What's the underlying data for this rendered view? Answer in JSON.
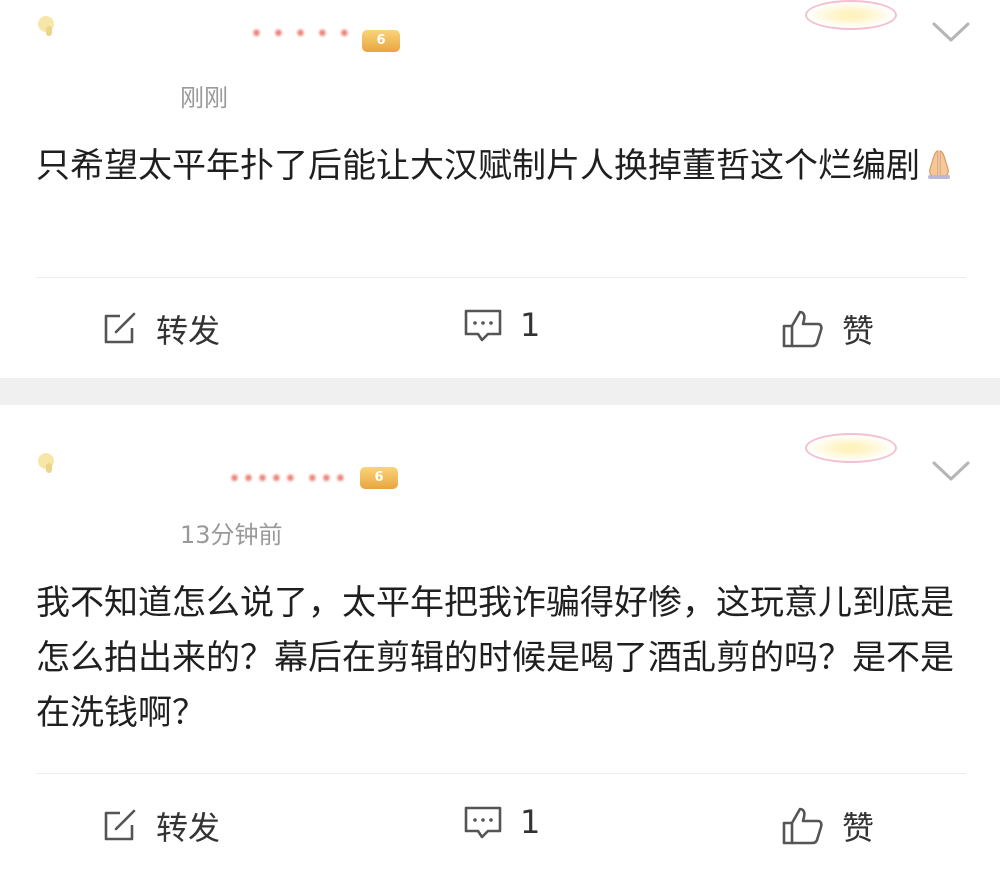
{
  "posts": [
    {
      "username": "• • • • •",
      "vip_badge": "6",
      "timestamp": "刚刚",
      "content": "只希望太平年扑了后能让大汉赋制片人换掉董哲这个烂编剧",
      "emoji": "pray-emoji",
      "actions": {
        "repost": "转发",
        "comment_count": "1",
        "like": "赞"
      }
    },
    {
      "username": "••••• •••",
      "vip_badge": "6",
      "timestamp": "13分钟前",
      "content": "我不知道怎么说了，太平年把我诈骗得好惨，这玩意儿到底是怎么拍出来的？幕后在剪辑的时候是喝了酒乱剪的吗？是不是在洗钱啊？",
      "actions": {
        "repost": "转发",
        "comment_count": "1",
        "like": "赞"
      }
    }
  ],
  "icons": {
    "avatar": "avatar-icon",
    "chevron": "chevron-down-icon",
    "repost": "edit-share-icon",
    "comment": "comment-bubble-icon",
    "like": "thumbs-up-icon"
  },
  "colors": {
    "timestamp": "#999999",
    "text": "#1f1f1f",
    "separator": "#f0f0f0",
    "username": "#e24d3b"
  }
}
